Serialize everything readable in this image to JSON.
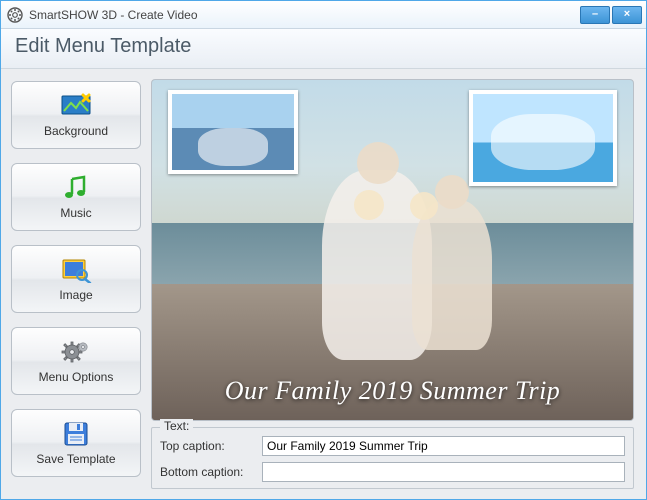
{
  "window": {
    "title": "SmartSHOW 3D - Create Video"
  },
  "header": {
    "title": "Edit Menu Template"
  },
  "sidebar": {
    "items": [
      {
        "label": "Background",
        "icon": "background-icon"
      },
      {
        "label": "Music",
        "icon": "music-icon"
      },
      {
        "label": "Image",
        "icon": "image-icon"
      },
      {
        "label": "Menu Options",
        "icon": "gear-icon"
      },
      {
        "label": "Save Template",
        "icon": "save-icon"
      }
    ]
  },
  "preview": {
    "caption_overlay": "Our Family 2019 Summer Trip"
  },
  "text_panel": {
    "legend": "Text:",
    "top_caption_label": "Top caption:",
    "top_caption_value": "Our Family 2019 Summer Trip",
    "bottom_caption_label": "Bottom caption:",
    "bottom_caption_value": ""
  },
  "colors": {
    "accent": "#3d94d6"
  }
}
